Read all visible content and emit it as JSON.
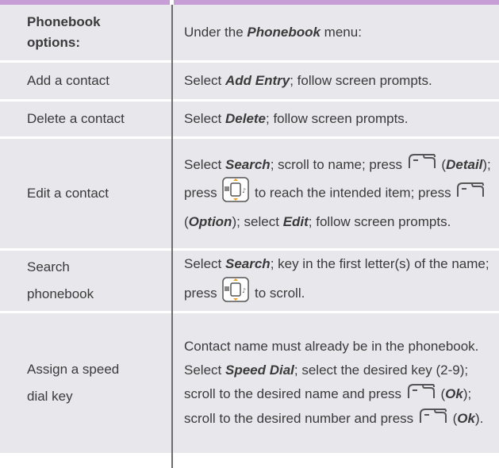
{
  "header": {
    "left": "Phonebook options:",
    "right_prefix": "Under the ",
    "right_bold": "Phonebook",
    "right_suffix": " menu:"
  },
  "rows": [
    {
      "option": "Add a contact",
      "t1": "Select ",
      "b1": "Add Entry",
      "t2": "; follow screen prompts."
    },
    {
      "option": "Delete a contact",
      "t1": "Select ",
      "b1": "Delete",
      "t2": "; follow screen prompts."
    },
    {
      "option": "Edit a contact",
      "t1": "Select ",
      "b1": "Search",
      "t2": "; scroll to name; press ",
      "t3": " (",
      "b2": "Detail",
      "t4": "); press ",
      "t5": " to reach the intended item; press ",
      "t6": " (",
      "b3": "Option",
      "t7": "); select ",
      "b4": "Edit",
      "t8": "; follow screen prompts."
    },
    {
      "option_line1": "Search",
      "option_line2": "phonebook",
      "t1": "Select ",
      "b1": "Search",
      "t2": "; key in the first letter(s) of the name; press ",
      "t3": " to scroll."
    },
    {
      "option_line1": "Assign a speed",
      "option_line2": "dial key",
      "t1": "Contact name must already be in the phonebook. Select ",
      "b1": "Speed Dial",
      "t2": "; select the desired key (2-9); scroll to the desired name and press ",
      "t3": " (",
      "b2": "Ok",
      "t4": "); scroll to the desired number and press ",
      "t5": " (",
      "b3": "Ok",
      "t6": ")."
    }
  ],
  "icons": {
    "softkey": "left-softkey-icon",
    "navkey": "navigation-key-icon"
  },
  "colors": {
    "accent_bar": "#c79dd6",
    "row_shade": "#e8e8ec",
    "divider": "#6d6d6d",
    "text": "#3a3a3a"
  }
}
